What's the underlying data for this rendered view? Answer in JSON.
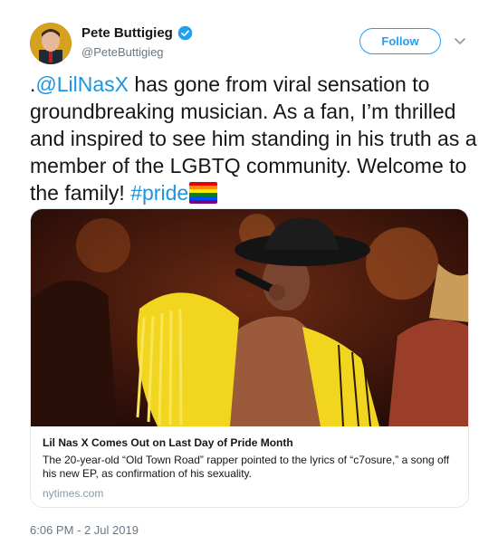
{
  "author": {
    "display_name": "Pete Buttigieg",
    "handle": "@PeteButtigieg",
    "verified": true
  },
  "follow_button": {
    "label": "Follow"
  },
  "tweet": {
    "mention": "@LilNasX",
    "text_part1": "has gone from viral sensation to groundbreaking musician. As a fan, I’m thrilled and inspired to see him standing in his truth as a member of the LGBTQ community. Welcome to the family!",
    "hashtag": "#pride",
    "emoji": "rainbow-flag"
  },
  "card": {
    "image": "performer-in-yellow-fringe-jacket-and-black-cowboy-hat",
    "title": "Lil Nas X Comes Out on Last Day of Pride Month",
    "description": "The 20-year-old “Old Town Road” rapper pointed to the lyrics of “c7osure,” a song off his new EP, as confirmation of his sexuality.",
    "domain": "nytimes.com"
  },
  "timestamp": "6:06 PM - 2 Jul 2019",
  "colors": {
    "link": "#1b95e0",
    "follow_accent": "#1da1f2",
    "secondary_text": "#657786",
    "card_border": "#e1e8ed"
  }
}
